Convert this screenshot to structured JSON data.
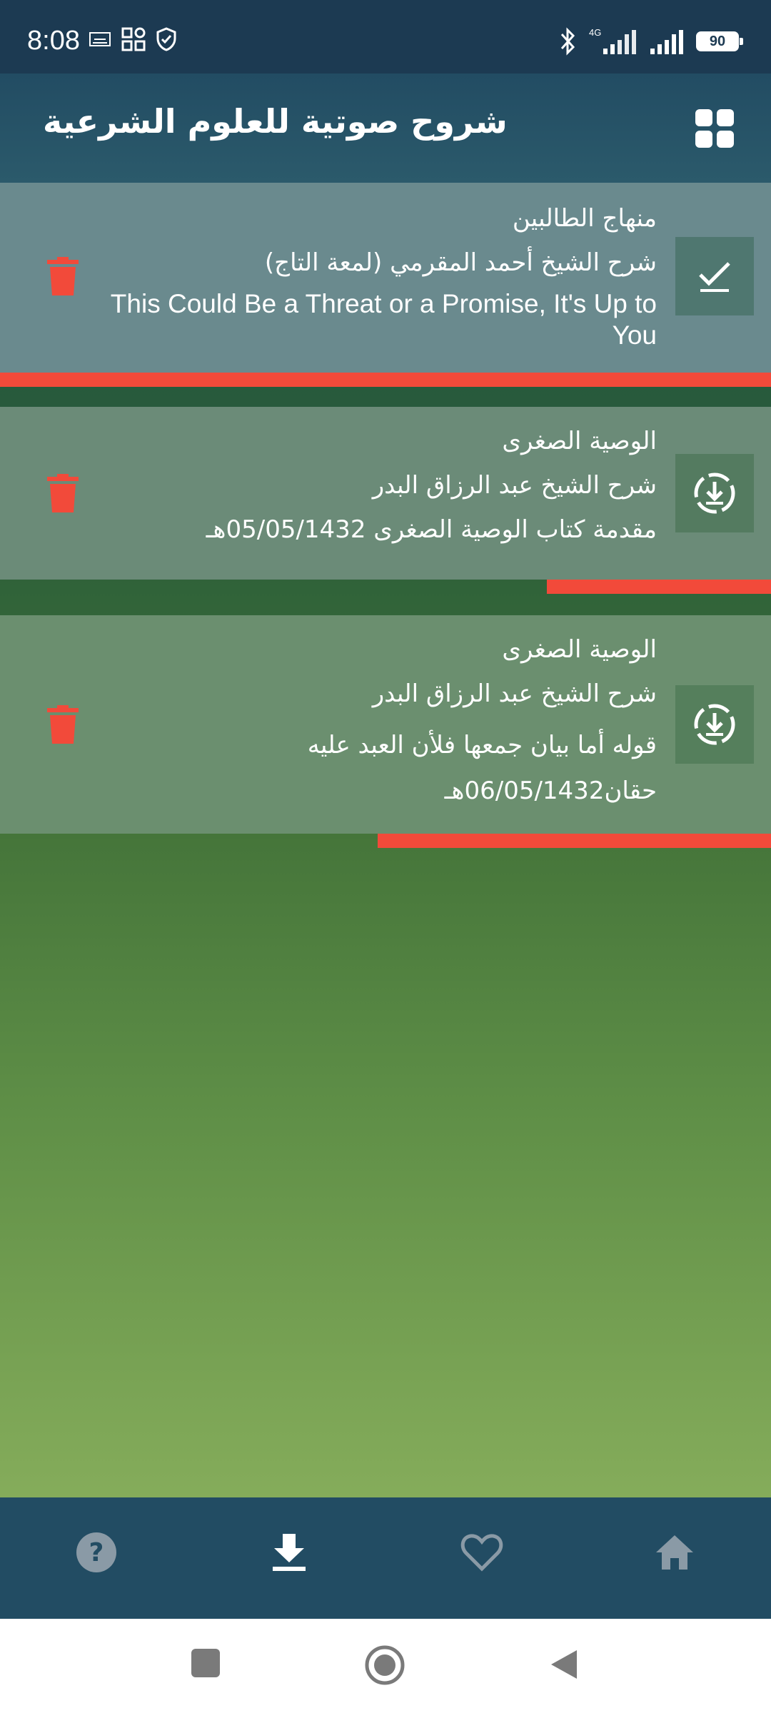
{
  "status_bar": {
    "time": "8:08",
    "battery": "90",
    "network": "4G"
  },
  "app_bar": {
    "title": "شروح صوتية للعلوم الشرعية",
    "menu_icon": "grid-icon"
  },
  "items": [
    {
      "book": "منهاج الطالبين",
      "sharh": "شرح الشيخ أحمد المقرمي (لمعة التاج)",
      "lesson": "This Could Be a Threat or a Promise, It's Up to You",
      "state": "downloaded",
      "action_icon": "check-icon",
      "progress": 1.0
    },
    {
      "book": "الوصية الصغرى",
      "sharh": "شرح الشيخ عبد الرزاق البدر",
      "lesson": "مقدمة كتاب الوصية الصغرى 05/05/1432هـ",
      "state": "not-downloaded",
      "action_icon": "download-circle-icon",
      "progress": 0.3
    },
    {
      "book": "الوصية الصغرى",
      "sharh": "شرح الشيخ عبد الرزاق البدر",
      "lesson": "قوله أما بيان جمعها فلأن العبد عليه حقان06/05/1432هـ",
      "state": "not-downloaded",
      "action_icon": "download-circle-icon",
      "progress": 0.52
    }
  ],
  "bottom_nav": [
    {
      "name": "help",
      "icon": "help-circle-icon",
      "active": false
    },
    {
      "name": "downloads",
      "icon": "download-icon",
      "active": true
    },
    {
      "name": "favorites",
      "icon": "heart-icon",
      "active": false
    },
    {
      "name": "home",
      "icon": "home-icon",
      "active": false
    }
  ],
  "colors": {
    "accent_red": "#f24a3a",
    "app_bar": "#224c63",
    "downloaded_row": "#6a8a8e",
    "row": "#6b8f76"
  }
}
